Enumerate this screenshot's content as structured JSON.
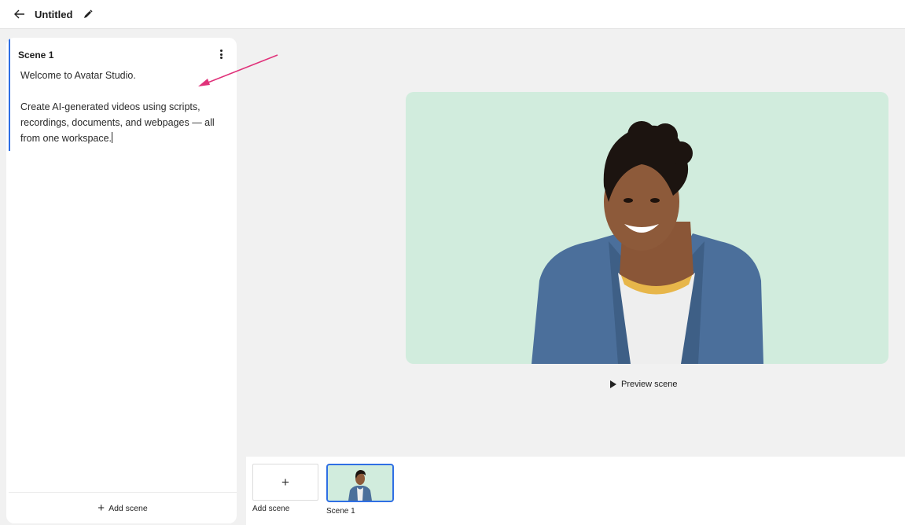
{
  "header": {
    "back_icon": "arrow-left-icon",
    "title": "Untitled",
    "edit_icon": "pencil-icon"
  },
  "script_panel": {
    "scene_title": "Scene 1",
    "menu_icon": "more-vertical-icon",
    "paragraphs": [
      "Welcome to Avatar Studio.",
      "Create AI-generated videos using scripts, recordings, documents, and webpages — all from one workspace."
    ],
    "add_scene_label": "Add scene",
    "add_icon": "plus-icon"
  },
  "preview": {
    "button_label": "Preview scene",
    "play_icon": "play-icon",
    "background_color": "#d1ecdd"
  },
  "timeline": {
    "add_tile_label": "Add scene",
    "scenes": [
      {
        "label": "Scene 1"
      }
    ]
  },
  "colors": {
    "accent": "#2f6fe4",
    "annotation_arrow": "#e0327a"
  }
}
